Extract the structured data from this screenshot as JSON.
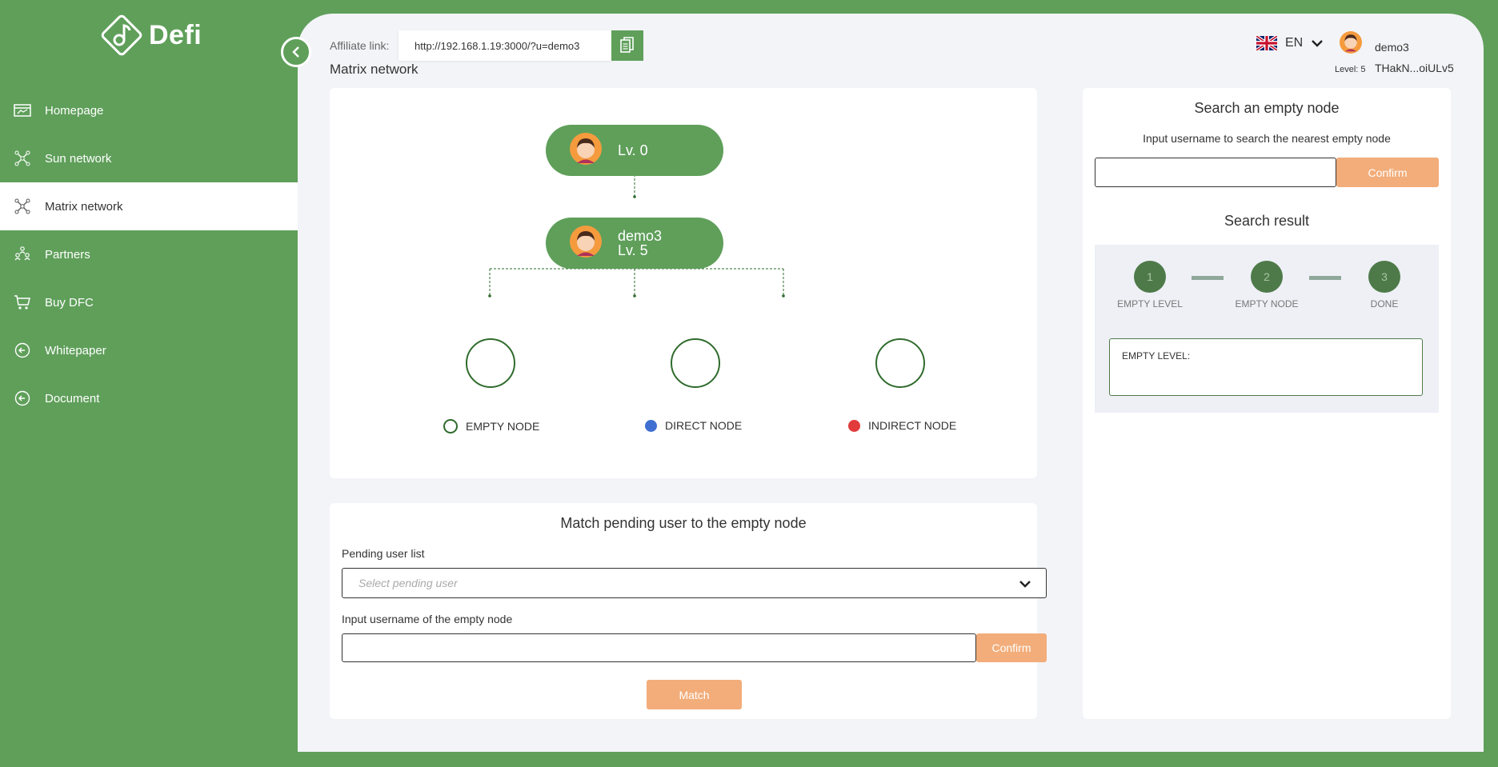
{
  "brand": {
    "name": "Defi",
    "logo_icon": "music-note-diamond-icon"
  },
  "sidebar": {
    "items": [
      {
        "label": "Homepage",
        "icon": "homepage-icon",
        "active": false
      },
      {
        "label": "Sun network",
        "icon": "network-icon",
        "active": false
      },
      {
        "label": "Matrix network",
        "icon": "network-icon",
        "active": true
      },
      {
        "label": "Partners",
        "icon": "partners-icon",
        "active": false
      },
      {
        "label": "Buy DFC",
        "icon": "cart-icon",
        "active": false
      },
      {
        "label": "Whitepaper",
        "icon": "arrow-circle-icon",
        "active": false
      },
      {
        "label": "Document",
        "icon": "arrow-circle-icon",
        "active": false
      }
    ]
  },
  "header": {
    "affiliate_label": "Affiliate link:",
    "affiliate_url": "http://192.168.1.19:3000/?u=demo3",
    "page_title": "Matrix network",
    "language": "EN",
    "user": {
      "name": "demo3",
      "level": "Level: 5",
      "address": "THakN...oiULv5"
    }
  },
  "tree": {
    "root": {
      "label": "Lv. 0"
    },
    "current": {
      "name": "demo3",
      "level": "Lv. 5"
    },
    "legend": {
      "empty": "EMPTY NODE",
      "direct": "DIRECT NODE",
      "indirect": "INDIRECT NODE"
    }
  },
  "match": {
    "title": "Match pending user to the empty node",
    "pending_label": "Pending user list",
    "pending_placeholder": "Select pending user",
    "empty_node_label": "Input username of the empty node",
    "confirm_label": "Confirm",
    "match_label": "Match"
  },
  "search": {
    "title": "Search an empty node",
    "subtitle": "Input username to search the nearest empty node",
    "confirm_label": "Confirm",
    "result_title": "Search result",
    "steps": [
      {
        "num": "1",
        "label": "EMPTY LEVEL"
      },
      {
        "num": "2",
        "label": "EMPTY NODE"
      },
      {
        "num": "3",
        "label": "DONE"
      }
    ],
    "empty_level_label": "EMPTY LEVEL:"
  },
  "colors": {
    "brand_green": "#5f9f5a",
    "accent_orange": "#f2ad7a",
    "direct_node": "#3f6fd1",
    "indirect_node": "#e23b3b",
    "empty_node_border": "#2f6b2c"
  }
}
